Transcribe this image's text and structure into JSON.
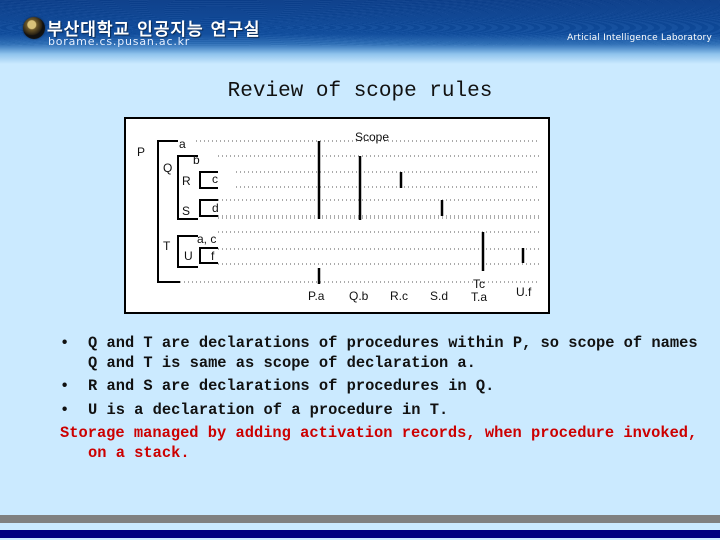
{
  "header": {
    "korean_title": "부산대학교 인공지능 연구실",
    "url": "borame.cs.pusan.ac.kr",
    "lab_name": "Articial Intelligence Laboratory",
    "logo_icon": "university-seal-icon"
  },
  "slide": {
    "title": "Review of scope rules"
  },
  "diagram": {
    "scope_label": "Scope",
    "procedures": [
      {
        "name": "P",
        "decls": "a"
      },
      {
        "name": "Q",
        "decls": "b"
      },
      {
        "name": "R",
        "decls": "c"
      },
      {
        "name": "S",
        "decls": "d"
      },
      {
        "name": "T",
        "decls": "a, c"
      },
      {
        "name": "U",
        "decls": "f"
      }
    ],
    "scope_labels": [
      "P.a",
      "Q.b",
      "R.c",
      "S.d",
      "Tc",
      "T.a",
      "U.f"
    ]
  },
  "bullets": [
    {
      "dot": "•",
      "text": "Q and T are declarations of procedures within P, so scope of names Q and T is same as scope of declaration a."
    },
    {
      "dot": "•",
      "text": "R and S are declarations of procedures in Q."
    },
    {
      "dot": "•",
      "text": "U is a declaration of a procedure in T."
    }
  ],
  "note": "Storage managed by adding activation records, when procedure invoked, on a stack.",
  "colors": {
    "background": "#cbeaff",
    "header_blue": "#0e4c9e",
    "note_red": "#cc0000",
    "bar_gray": "#808080",
    "bar_navy": "#000080"
  }
}
